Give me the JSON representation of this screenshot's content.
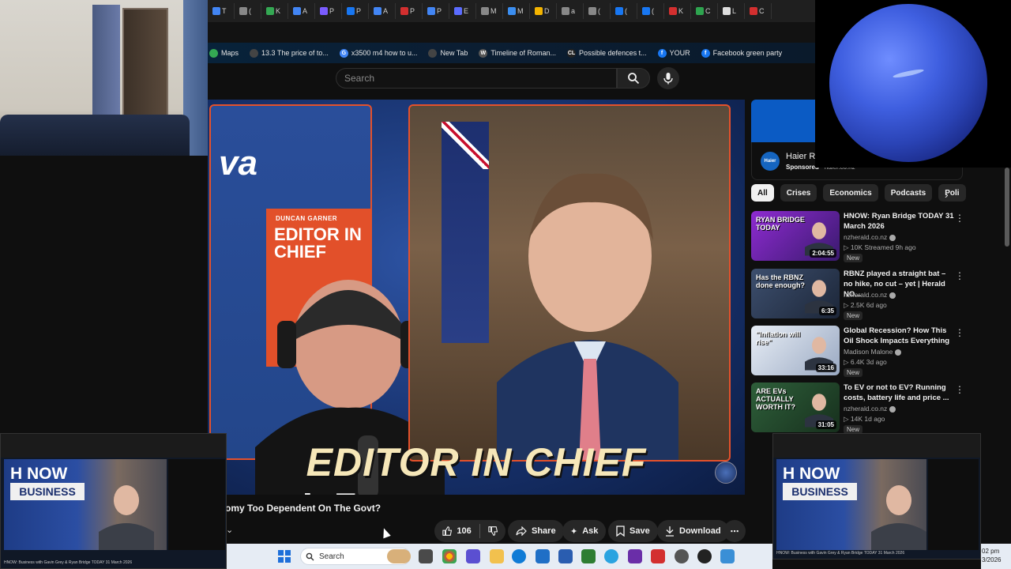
{
  "browser": {
    "tabs": [
      "T",
      "(",
      "K",
      "A",
      "P",
      "P",
      "A",
      "P",
      "P",
      "E",
      "M",
      "M",
      "D",
      "a",
      "(",
      "(",
      "(",
      "K",
      "C",
      "L",
      "C"
    ],
    "bookmarks": [
      {
        "label": "Maps",
        "icon_color": "#34a853"
      },
      {
        "label": "13.3 The price of to...",
        "icon_color": "#444444"
      },
      {
        "label": "x3500 m4 how to u...",
        "icon_color": "#4285f4",
        "icon_text": "G"
      },
      {
        "label": "New Tab",
        "icon_color": "#444444"
      },
      {
        "label": "Timeline of Roman...",
        "icon_color": "#555555",
        "icon_text": "W"
      },
      {
        "label": "Possible defences t...",
        "icon_color": "#222222",
        "icon_text": "CL"
      },
      {
        "label": "YOUR",
        "icon_color": "#1877f2",
        "icon_text": "f"
      },
      {
        "label": "Facebook green party",
        "icon_color": "#1877f2",
        "icon_text": "f"
      }
    ]
  },
  "header": {
    "search_placeholder": "Search"
  },
  "video": {
    "logo_fragment": "va",
    "poster_small": "DUNCAN GARNER",
    "poster_big": "EDITOR IN CHIEF",
    "overlay_title": "EDITOR IN CHIEF",
    "title": "omy Too Dependent On The Govt?",
    "likes": "106",
    "share_label": "Share",
    "ask_label": "Ask",
    "save_label": "Save",
    "download_label": "Download"
  },
  "ad": {
    "logo_text": "Haier",
    "title": "Haier Re",
    "sponsored": "Sponsored",
    "domain": "haier.co.nz"
  },
  "chips": [
    "All",
    "Crises",
    "Economics",
    "Podcasts",
    "Poli"
  ],
  "recommendations": [
    {
      "title": "HNOW: Ryan Bridge TODAY 31 March 2026",
      "channel": "nzherald.co.nz",
      "stats": "10K  Streamed 9h ago",
      "badge": "New",
      "duration": "2:04:55",
      "thumb_text": "RYAN BRIDGE TODAY",
      "thumb_colors": [
        "#8e2bd1",
        "#3a1a6e"
      ]
    },
    {
      "title": "RBNZ played a straight bat – no hike, no cut – yet | Herald NO...",
      "channel": "nzherald.co.nz",
      "stats": "2.5K  6d ago",
      "badge": "New",
      "duration": "6:35",
      "thumb_text": "Has the RBNZ done enough?",
      "thumb_colors": [
        "#3d4f6e",
        "#1c2638"
      ]
    },
    {
      "title": "Global Recession? How This Oil Shock Impacts Everything",
      "channel": "Madison Malone",
      "stats": "6.4K  3d ago",
      "badge": "New",
      "duration": "33:16",
      "thumb_text": "\"Inflation will rise\"",
      "thumb_colors": [
        "#e8eef6",
        "#9aa9c2"
      ]
    },
    {
      "title": "To EV or not to EV? Running costs, battery life and price ...",
      "channel": "nzherald.co.nz",
      "stats": "14K  1d ago",
      "badge": "New",
      "duration": "31:05",
      "thumb_text": "ARE EVs ACTUALLY WORTH IT?",
      "thumb_colors": [
        "#2e5f3a",
        "#17301d"
      ]
    }
  ],
  "pip": {
    "label": "NOW",
    "sub": "BUSINESS",
    "caption": "HNOW: Business with Gavin Grey & Ryan Bridge TODAY 31 March 2026"
  },
  "taskbar": {
    "search_label": "Search",
    "time": "02 pm",
    "date": "3/2026"
  },
  "colors": {
    "accent_orange": "#e4512b",
    "yt_bg": "#0f0f0f",
    "overlay_title": "#f6e7b8"
  }
}
